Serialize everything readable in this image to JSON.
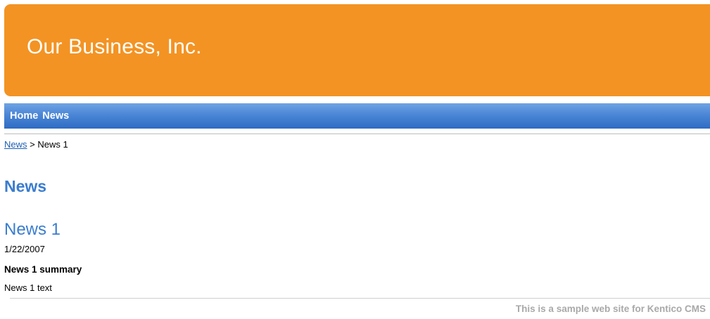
{
  "header": {
    "site_title": "Our Business, Inc.",
    "background_color": "#f39323"
  },
  "nav": {
    "items": [
      {
        "label": "Home"
      },
      {
        "label": "News"
      }
    ],
    "background_color": "#4b86d6"
  },
  "breadcrumb": {
    "link_label": "News",
    "separator": " > ",
    "current": "News 1"
  },
  "main": {
    "heading": "News",
    "article": {
      "title": "News 1",
      "date": "1/22/2007",
      "summary": "News 1 summary",
      "text": "News 1 text"
    },
    "accent_color": "#3a7dcf"
  },
  "footer": {
    "text": "This is a sample web site for Kentico CMS"
  }
}
